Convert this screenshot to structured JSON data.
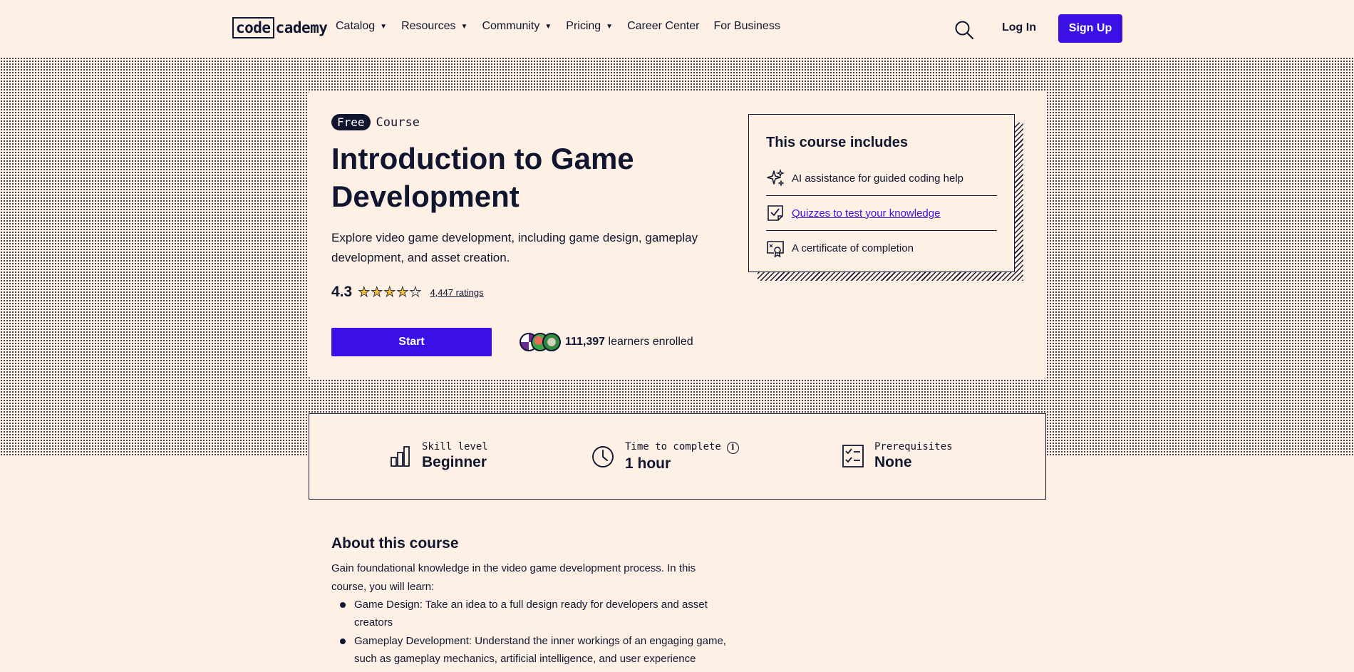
{
  "header": {
    "logo_boxed": "code",
    "logo_rest": "cademy",
    "nav": [
      {
        "label": "Catalog",
        "caret": true
      },
      {
        "label": "Resources",
        "caret": true
      },
      {
        "label": "Community",
        "caret": true
      },
      {
        "label": "Pricing",
        "caret": true
      },
      {
        "label": "Career Center",
        "caret": false
      },
      {
        "label": "For Business",
        "caret": false
      }
    ],
    "login_label": "Log In",
    "signup_label": "Sign Up"
  },
  "course": {
    "badge": "Free",
    "type": "Course",
    "title": "Introduction to Game Development",
    "description": "Explore video game development, including game design, gameplay development, and asset creation.",
    "rating": "4.3",
    "rating_value": 4.3,
    "ratings_count": "4,447 ratings",
    "start_label": "Start",
    "learners_count": "111,397",
    "learners_suffix": " learners enrolled"
  },
  "includes": {
    "title": "This course includes",
    "items": [
      {
        "icon": "sparkle-icon",
        "label": "AI assistance for guided coding help",
        "link": false
      },
      {
        "icon": "quiz-icon",
        "label": "Quizzes to test your knowledge",
        "link": true
      },
      {
        "icon": "certificate-icon",
        "label": "A certificate of completion",
        "link": false
      }
    ]
  },
  "stats": {
    "skill_label": "Skill level",
    "skill_value": "Beginner",
    "time_label": "Time to complete",
    "time_value": "1 hour",
    "prereq_label": "Prerequisites",
    "prereq_value": "None"
  },
  "about": {
    "title": "About this course",
    "intro": "Gain foundational knowledge in the video game development process. In this course, you will learn:",
    "items": [
      "Game Design: Take an idea to a full design ready for developers and asset creators",
      "Gameplay Development: Understand the inner workings of an engaging game, such as gameplay mechanics, artificial intelligence, and user experience"
    ]
  },
  "colors": {
    "brand": "#3a10e5",
    "ink": "#10162f",
    "background": "#fff0e5",
    "star": "#f2c23c"
  }
}
